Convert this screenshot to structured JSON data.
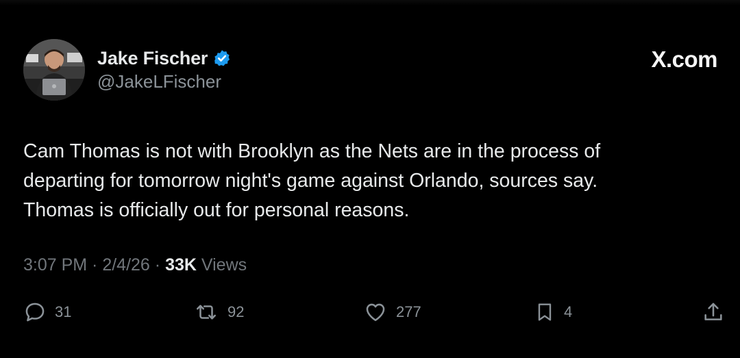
{
  "author": {
    "display_name": "Jake Fischer",
    "handle": "@JakeLFischer",
    "verified": true
  },
  "brand": "X.com",
  "tweet": {
    "lines": [
      "Cam Thomas is not with Brooklyn as the Nets are in the process of",
      "departing for tomorrow night's game against Orlando, sources say.",
      "Thomas is officially out for personal reasons."
    ]
  },
  "meta": {
    "time": "3:07 PM",
    "sep1": " · ",
    "date": "2/4/26",
    "sep2": " · ",
    "views_count": "33K",
    "views_label": " Views"
  },
  "actions": {
    "replies": "31",
    "reposts": "92",
    "likes": "277",
    "bookmarks": "4"
  },
  "colors": {
    "background": "#000000",
    "text": "#e7e9ea",
    "muted": "#71767b",
    "verified": "#1d9bf0"
  }
}
